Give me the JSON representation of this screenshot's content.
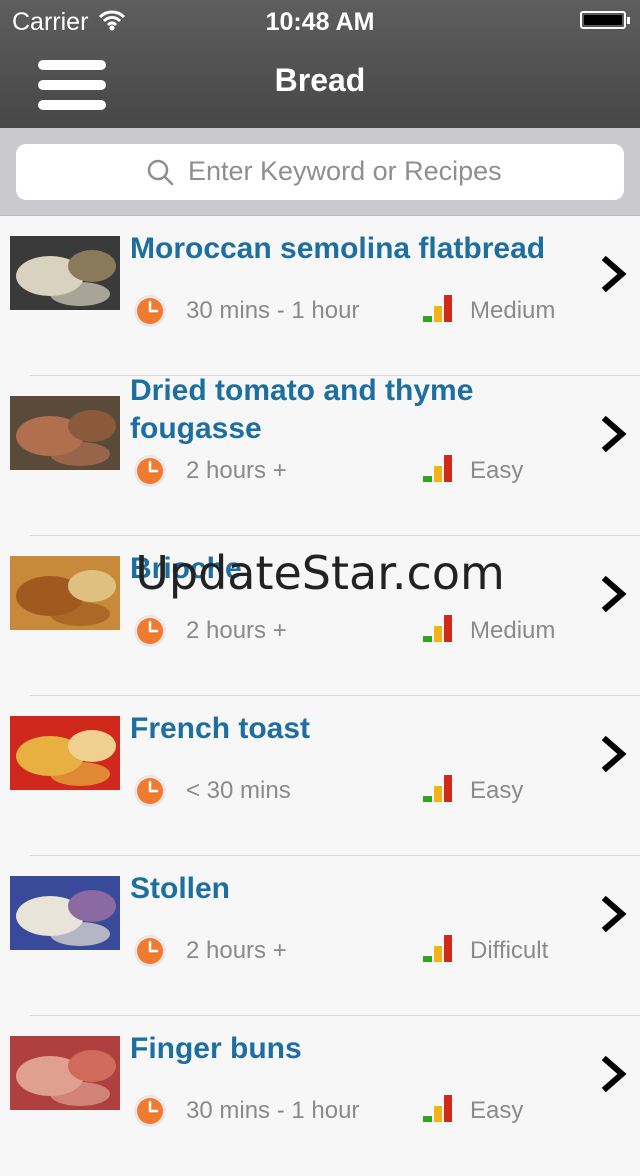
{
  "status": {
    "carrier": "Carrier",
    "time": "10:48 AM"
  },
  "nav": {
    "title": "Bread"
  },
  "search": {
    "placeholder": "Enter Keyword or Recipes"
  },
  "recipes": [
    {
      "title": "Moroccan semolina flatbread",
      "duration": "30 mins - 1 hour",
      "difficulty": "Medium",
      "thumb_colors": [
        "#3a3a3a",
        "#d9d2c0",
        "#8a7a5c"
      ]
    },
    {
      "title": "Dried tomato and thyme fougasse",
      "duration": "2 hours +",
      "difficulty": "Easy",
      "thumb_colors": [
        "#5a4a3a",
        "#b07050",
        "#8a5a3a"
      ]
    },
    {
      "title": "Brioche",
      "duration": "2 hours +",
      "difficulty": "Medium",
      "thumb_colors": [
        "#c88a3a",
        "#a05a20",
        "#e0c080"
      ]
    },
    {
      "title": "French toast",
      "duration": "< 30 mins",
      "difficulty": "Easy",
      "thumb_colors": [
        "#d0281c",
        "#e8b040",
        "#f0d090"
      ]
    },
    {
      "title": "Stollen",
      "duration": "2 hours +",
      "difficulty": "Difficult",
      "thumb_colors": [
        "#3a4a9a",
        "#e8e4d8",
        "#8a6aa0"
      ]
    },
    {
      "title": "Finger buns",
      "duration": "30 mins - 1 hour",
      "difficulty": "Easy",
      "thumb_colors": [
        "#b04040",
        "#e0a090",
        "#d06a5a"
      ]
    }
  ],
  "watermark": "UpdateStar.com",
  "colors": {
    "accent": "#1e6fa0",
    "header": "#4f4f4f",
    "clock": "#f07a30"
  }
}
